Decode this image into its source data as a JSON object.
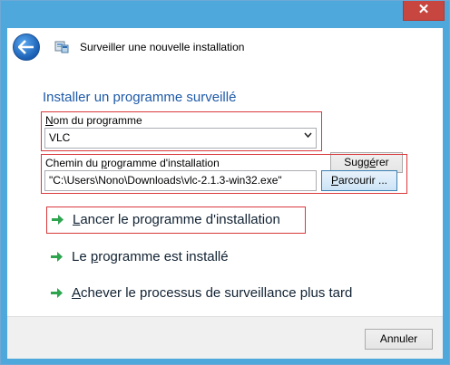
{
  "window": {
    "close_glyph": "✕",
    "accent": "#4fa8dc",
    "close_color": "#c7463f"
  },
  "header": {
    "title": "Surveiller une nouvelle installation",
    "back_icon": "back-arrow-icon",
    "app_icon": "installer-monitor-icon"
  },
  "main": {
    "section_title": "Installer un programme surveillé",
    "program_name": {
      "label_mnemonic": "N",
      "label_rest": "om du programme",
      "value": "VLC",
      "suggest_prefix": "Sugg",
      "suggest_mnemonic": "é",
      "suggest_suffix": "rer"
    },
    "install_path": {
      "label_prefix": "Chemin du ",
      "label_mnemonic": "p",
      "label_suffix": "rogramme d'installation",
      "value": "\"C:\\Users\\Nono\\Downloads\\vlc-2.1.3-win32.exe\"",
      "browse_mnemonic": "P",
      "browse_rest": "arcourir ..."
    },
    "commands": {
      "launch": {
        "mnemonic": "L",
        "rest": "ancer le programme d'installation"
      },
      "installed_prefix": "Le ",
      "installed_mnemonic": "p",
      "installed_suffix": "rogramme est installé",
      "later": {
        "mnemonic": "A",
        "rest": "chever le processus de surveillance plus tard"
      }
    },
    "highlight_color": "#d9383c",
    "title_color": "#1e5aa8",
    "command_arrow_color": "#2ea44f"
  },
  "footer": {
    "cancel_label": "Annuler"
  }
}
